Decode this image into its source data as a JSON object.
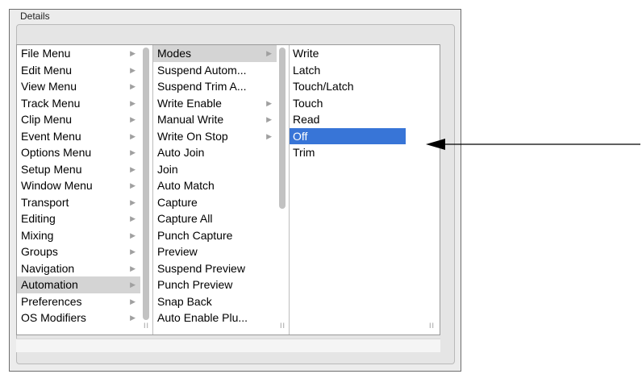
{
  "window": {
    "title": "Details"
  },
  "columns": {
    "menus": [
      {
        "label": "File Menu",
        "arrow": "▶"
      },
      {
        "label": "Edit Menu",
        "arrow": "▶"
      },
      {
        "label": "View Menu",
        "arrow": "▶"
      },
      {
        "label": "Track Menu",
        "arrow": "▶"
      },
      {
        "label": "Clip Menu",
        "arrow": "▶"
      },
      {
        "label": "Event Menu",
        "arrow": "▶"
      },
      {
        "label": "Options Menu",
        "arrow": "▶"
      },
      {
        "label": "Setup Menu",
        "arrow": "▶"
      },
      {
        "label": "Window Menu",
        "arrow": "▶"
      },
      {
        "label": "Transport",
        "arrow": "▶"
      },
      {
        "label": "Editing",
        "arrow": "▶"
      },
      {
        "label": "Mixing",
        "arrow": "▶"
      },
      {
        "label": "Groups",
        "arrow": "▶"
      },
      {
        "label": "Navigation",
        "arrow": "▶"
      },
      {
        "label": "Automation",
        "arrow": "▶"
      },
      {
        "label": "Preferences",
        "arrow": "▶"
      },
      {
        "label": "OS Modifiers",
        "arrow": "▶"
      }
    ],
    "automation": [
      {
        "label": "Modes",
        "arrow": "▶"
      },
      {
        "label": "Suspend Autom...",
        "arrow": ""
      },
      {
        "label": "Suspend Trim A...",
        "arrow": ""
      },
      {
        "label": "Write Enable",
        "arrow": "▶"
      },
      {
        "label": "Manual Write",
        "arrow": "▶"
      },
      {
        "label": "Write On Stop",
        "arrow": "▶"
      },
      {
        "label": "Auto Join",
        "arrow": ""
      },
      {
        "label": "Join",
        "arrow": ""
      },
      {
        "label": "Auto Match",
        "arrow": ""
      },
      {
        "label": "Capture",
        "arrow": ""
      },
      {
        "label": "Capture All",
        "arrow": ""
      },
      {
        "label": "Punch Capture",
        "arrow": ""
      },
      {
        "label": "Preview",
        "arrow": ""
      },
      {
        "label": "Suspend Preview",
        "arrow": ""
      },
      {
        "label": "Punch Preview",
        "arrow": ""
      },
      {
        "label": "Snap Back",
        "arrow": ""
      },
      {
        "label": "Auto Enable Plu...",
        "arrow": ""
      }
    ],
    "modes": [
      {
        "label": "Write"
      },
      {
        "label": "Latch"
      },
      {
        "label": "Touch/Latch"
      },
      {
        "label": "Touch"
      },
      {
        "label": "Read"
      },
      {
        "label": "Off"
      },
      {
        "label": "Trim"
      }
    ],
    "grip": "II"
  },
  "selection": {
    "menus_index": 14,
    "automation_index": 0,
    "modes_index": 5,
    "highlight_color": "#3875d7",
    "inactive_color": "#d4d4d4"
  }
}
